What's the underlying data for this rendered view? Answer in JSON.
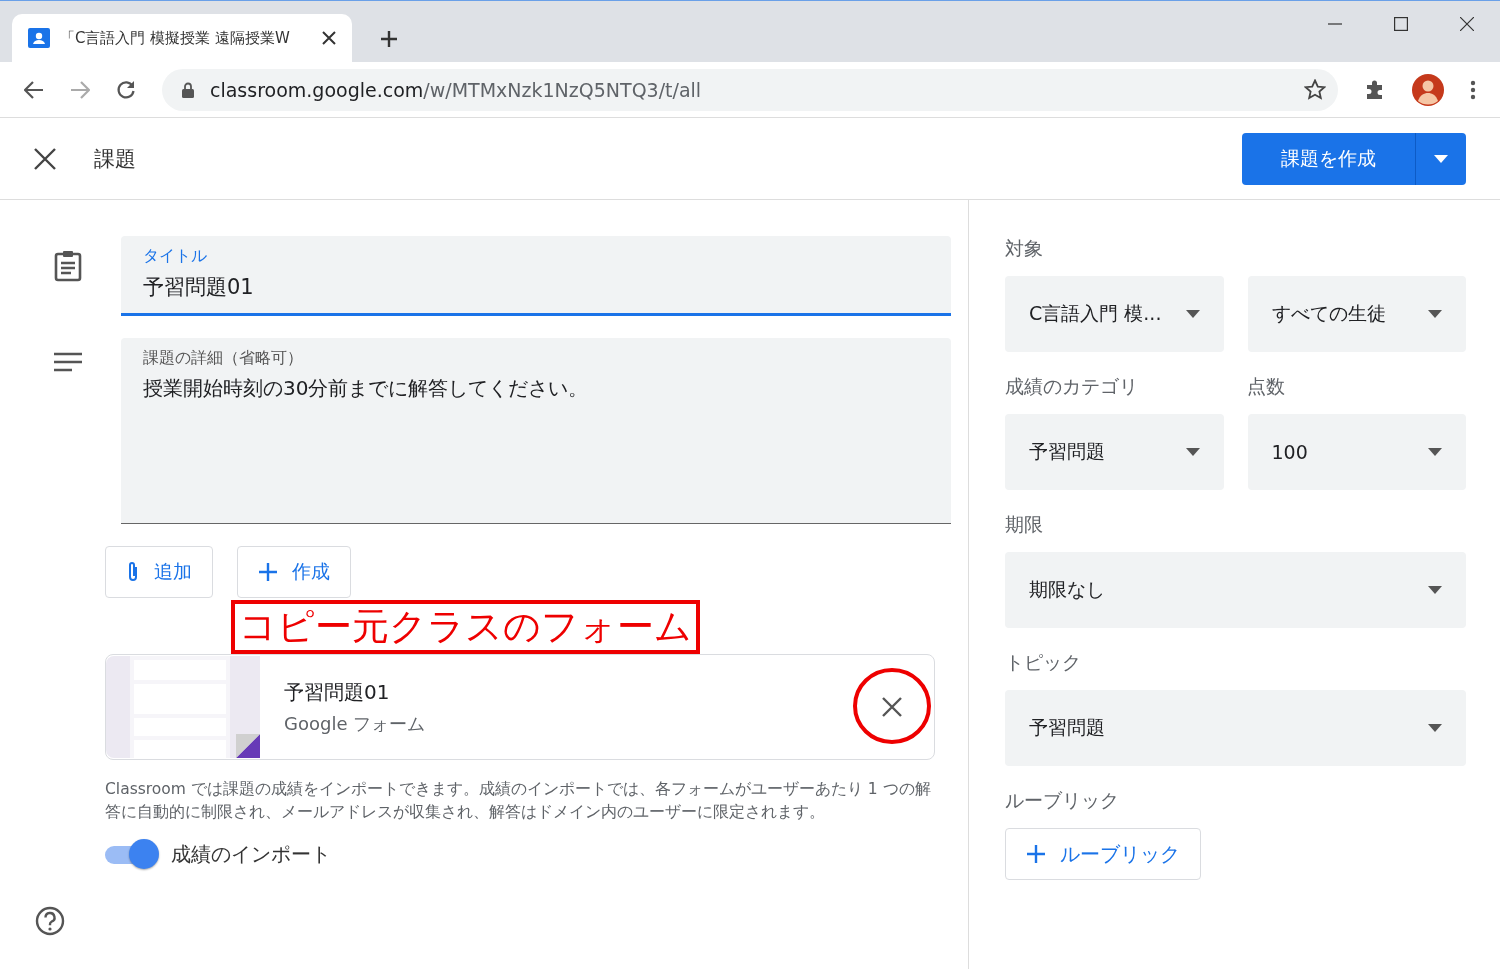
{
  "browser": {
    "tab_title": "「C言語入門 模擬授業 遠隔授業W",
    "url_host": "classroom.google.com",
    "url_path": "/w/MTMxNzk1NzQ5NTQ3/t/all"
  },
  "header": {
    "title": "課題",
    "create_button": "課題を作成"
  },
  "title_field": {
    "label": "タイトル",
    "value": "予習問題01",
    "focused": true
  },
  "details_field": {
    "label": "課題の詳細（省略可）",
    "value": "授業開始時刻の30分前までに解答してください。"
  },
  "attach_buttons": [
    {
      "kind": "attach",
      "label": "追加"
    },
    {
      "kind": "create",
      "label": "作成"
    }
  ],
  "annotation": {
    "label": "コピー元クラスのフォーム",
    "circle_close": true
  },
  "attachment": {
    "title": "予習問題01",
    "type": "Google フォーム"
  },
  "import_note": "Classroom では課題の成績をインポートできます。成績のインポートでは、各フォームがユーザーあたり 1 つの解答に自動的に制限され、メールアドレスが収集され、解答はドメイン内のユーザーに限定されます。",
  "import_toggle": {
    "label": "成績のインポート",
    "on": true
  },
  "sidebar": {
    "sections": [
      {
        "label": "対象",
        "fields": [
          {
            "value": "C言語入門 模..."
          },
          {
            "value": "すべての生徒"
          }
        ]
      },
      {
        "labels": [
          "成績のカテゴリ",
          "点数"
        ],
        "fields": [
          {
            "value": "予習問題"
          },
          {
            "value": "100"
          }
        ]
      },
      {
        "label": "期限",
        "fields": [
          {
            "value": "期限なし"
          }
        ]
      },
      {
        "label": "トピック",
        "fields": [
          {
            "value": "予習問題"
          }
        ]
      }
    ],
    "rubric": {
      "label": "ルーブリック",
      "button": "ルーブリック"
    }
  }
}
